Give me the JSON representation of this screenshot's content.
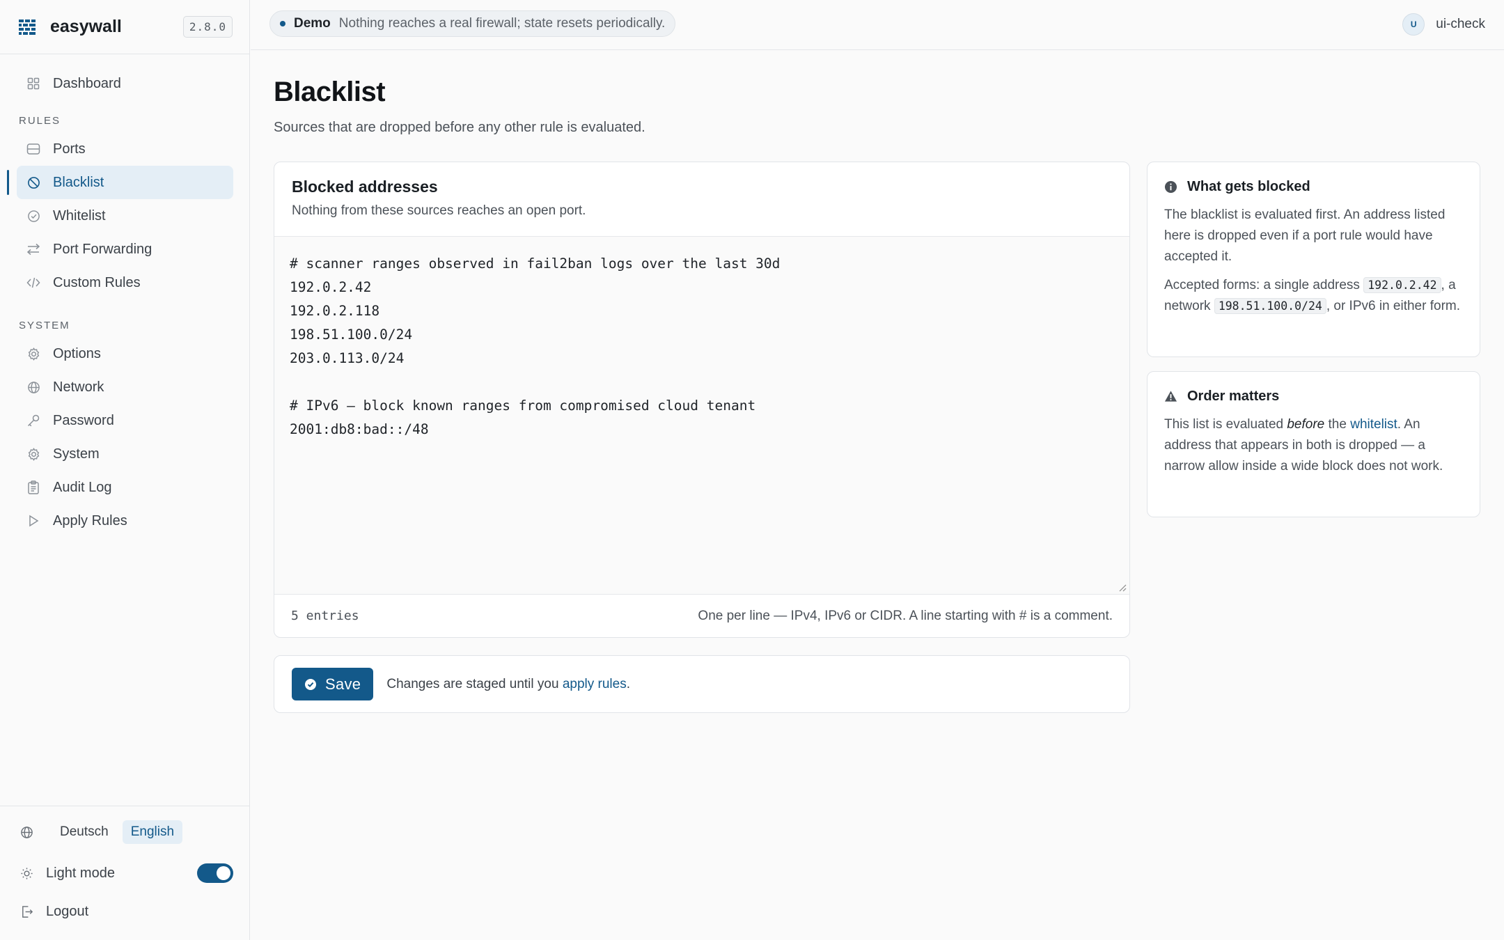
{
  "brand": {
    "name": "easywall",
    "version": "2.8.0",
    "accent": "#13598a"
  },
  "nav": {
    "dashboard": {
      "label": "Dashboard",
      "icon": "grid-icon"
    },
    "rules_section": "RULES",
    "rules": [
      {
        "label": "Ports",
        "icon": "server-icon"
      },
      {
        "label": "Blacklist",
        "icon": "block-icon",
        "active": true
      },
      {
        "label": "Whitelist",
        "icon": "check-circle-icon"
      },
      {
        "label": "Port Forwarding",
        "icon": "arrows-icon"
      },
      {
        "label": "Custom Rules",
        "icon": "code-icon"
      }
    ],
    "system_section": "SYSTEM",
    "system": [
      {
        "label": "Options",
        "icon": "gear-icon"
      },
      {
        "label": "Network",
        "icon": "globe-icon"
      },
      {
        "label": "Password",
        "icon": "key-icon"
      },
      {
        "label": "System",
        "icon": "gear-icon"
      },
      {
        "label": "Audit Log",
        "icon": "clipboard-icon"
      },
      {
        "label": "Apply Rules",
        "icon": "play-icon"
      }
    ]
  },
  "footer": {
    "languages": [
      "Deutsch",
      "English"
    ],
    "active_language": "English",
    "theme_label": "Light mode",
    "theme_toggle_on": true,
    "logout_label": "Logout"
  },
  "topbar": {
    "demo_label": "Demo",
    "demo_text": "Nothing reaches a real firewall; state resets periodically.",
    "user_initial": "U",
    "username": "ui-check"
  },
  "page": {
    "title": "Blacklist",
    "subtitle": "Sources that are dropped before any other rule is evaluated."
  },
  "editor": {
    "title": "Blocked addresses",
    "subtitle": "Nothing from these sources reaches an open port.",
    "lines": [
      "# scanner ranges observed in fail2ban logs over the last 30d",
      "192.0.2.42",
      "192.0.2.118",
      "198.51.100.0/24",
      "203.0.113.0/24",
      "",
      "# IPv6 — block known ranges from compromised cloud tenant",
      "2001:db8:bad::/48"
    ],
    "entry_count": "5 entries",
    "hint": "One per line — IPv4, IPv6 or CIDR. A line starting with # is a comment."
  },
  "save": {
    "button_label": "Save",
    "note_prefix": "Changes are staged until you",
    "note_link": "apply rules",
    "note_suffix": "."
  },
  "info": {
    "title": "What gets blocked",
    "p1": "The blacklist is evaluated first. An address listed here is dropped even if a port rule would have accepted it.",
    "p2_prefix": "Accepted forms: a single address",
    "p2_code1": "192.0.2.42",
    "p2_mid": ", a network",
    "p2_code2": "198.51.100.0/24",
    "p2_suffix": ", or IPv6 in either form."
  },
  "order": {
    "title": "Order matters",
    "p_prefix": "This list is evaluated",
    "p_em": "before",
    "p_mid": "the",
    "p_link": "whitelist",
    "p_suffix": ". An address that appears in both is dropped — a narrow allow inside a wide block does not work."
  }
}
